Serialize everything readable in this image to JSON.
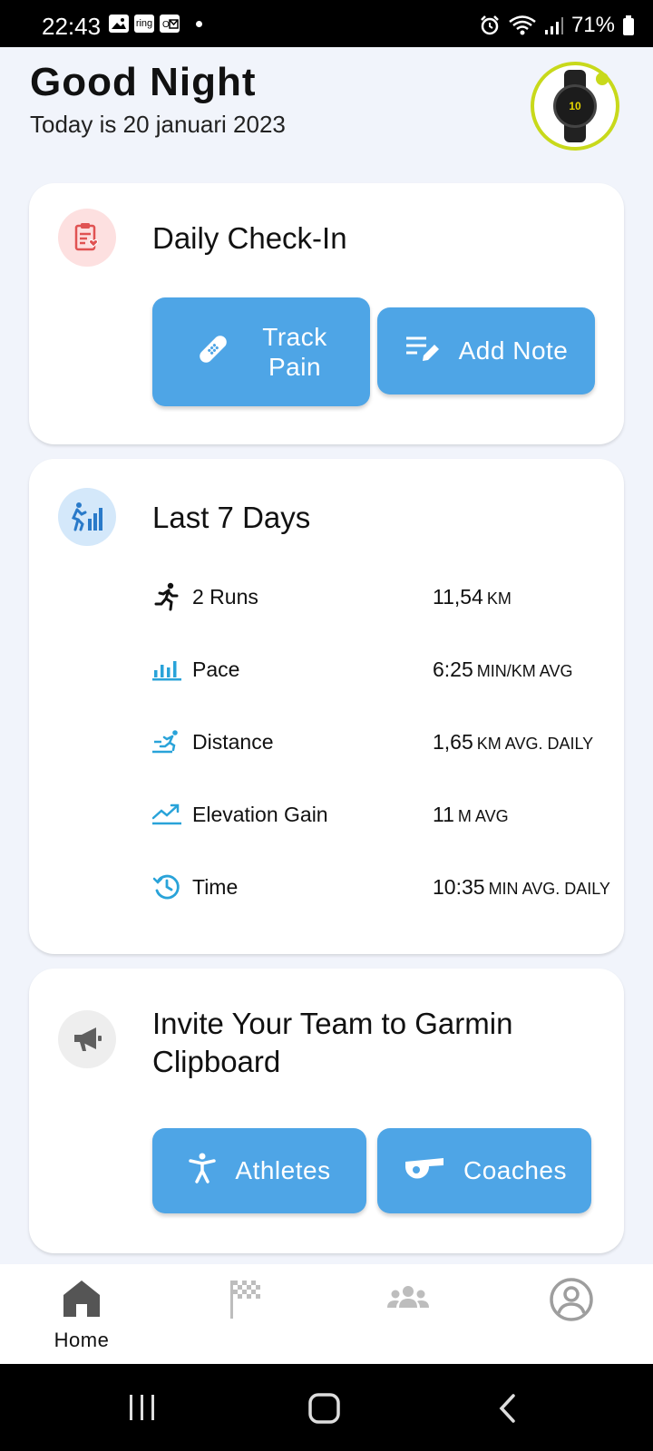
{
  "status_bar": {
    "time": "22:43",
    "battery": "71%",
    "notification_icons": [
      "gallery-icon",
      "ring-icon",
      "outlook-icon"
    ]
  },
  "header": {
    "greeting": "Good Night",
    "date": "Today is 20 januari 2023",
    "watch_face_text": "10"
  },
  "daily_checkin": {
    "title": "Daily Check-In",
    "track_pain_line1": "Track",
    "track_pain_line2": "Pain",
    "add_note": "Add Note"
  },
  "last_7_days": {
    "title": "Last 7 Days",
    "stats": [
      {
        "icon": "run-icon",
        "label": "2 Runs",
        "value": "11,54",
        "unit": "KM"
      },
      {
        "icon": "bar-chart-icon",
        "label": "Pace",
        "value": "6:25",
        "unit": "MIN/KM AVG"
      },
      {
        "icon": "sprint-icon",
        "label": "Distance",
        "value": "1,65",
        "unit": "KM AVG. DAILY"
      },
      {
        "icon": "trend-up-icon",
        "label": "Elevation Gain",
        "value": "11",
        "unit": "M AVG"
      },
      {
        "icon": "history-icon",
        "label": "Time",
        "value": "10:35",
        "unit": "MIN AVG. DAILY"
      }
    ]
  },
  "invite": {
    "title_line1": "Invite Your Team to Garmin",
    "title_line2": "Clipboard",
    "athletes": "Athletes",
    "coaches": "Coaches"
  },
  "bottom_nav": {
    "home": "Home"
  },
  "colors": {
    "accent_blue": "#4ea5e6",
    "watch_ring": "#c8d91b",
    "checkin_icon_bg": "#fde0e0",
    "days_icon_bg": "#d4e8fa",
    "invite_icon_bg": "#eeeeee"
  }
}
